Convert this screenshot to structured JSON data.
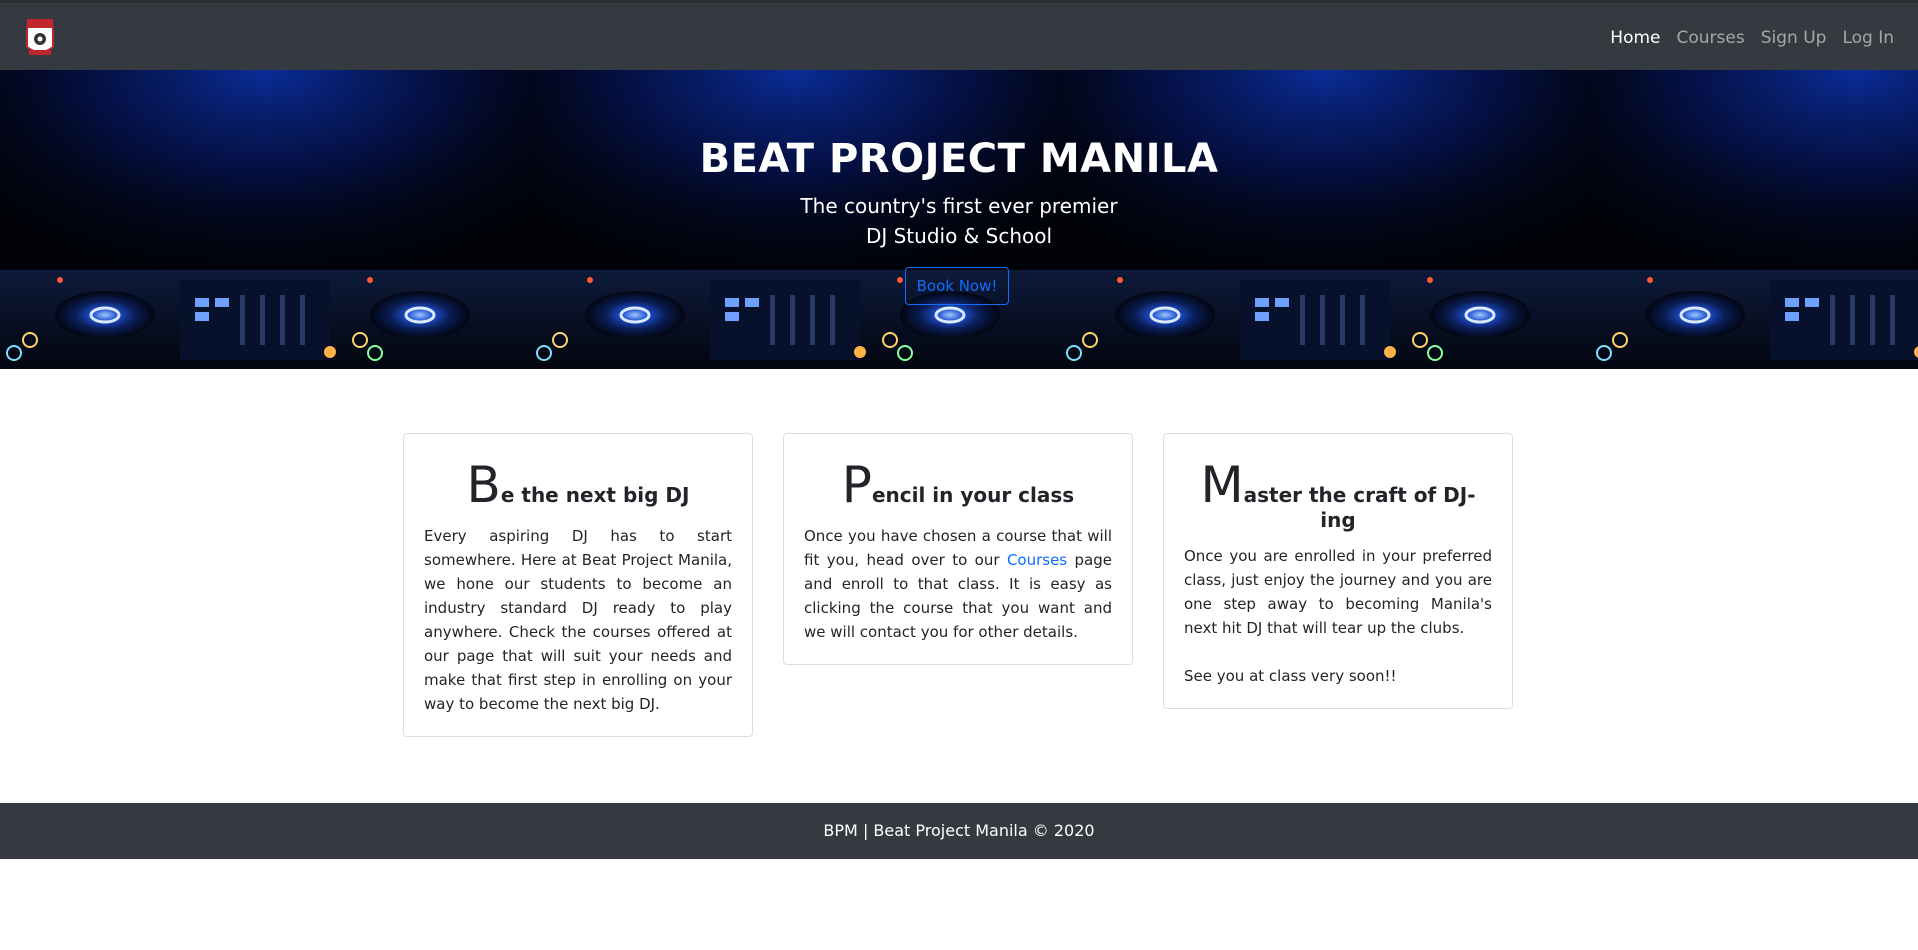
{
  "nav": {
    "logo": "logo-badge",
    "links": [
      {
        "label": "Home",
        "active": true
      },
      {
        "label": "Courses",
        "active": false
      },
      {
        "label": "Sign Up",
        "active": false
      },
      {
        "label": "Log In",
        "active": false
      }
    ]
  },
  "hero": {
    "title": "BEAT PROJECT MANILA",
    "subtitle_line1": "The country's first ever premier",
    "subtitle_line2": "DJ Studio & School",
    "button_label": "Book Now!"
  },
  "cards": [
    {
      "initial": "B",
      "title_rest": "e the next big DJ",
      "text": "Every aspiring DJ has to start somewhere. Here at Beat Project Manila, we hone our students to become an industry standard DJ ready to play anywhere. Check the courses offered at our page that will suit your needs and make that first step in enrolling on your way to become the next big DJ."
    },
    {
      "initial": "P",
      "title_rest": "encil in your class",
      "text_before": "Once you have chosen a course that will fit you, head over to our ",
      "link": "Courses",
      "text_after": " page and enroll to that class. It is easy as clicking the course that you want and we will contact you for other details."
    },
    {
      "initial": "M",
      "title_rest": "aster the craft of DJ-ing",
      "text": "Once you are enrolled in your preferred class, just enjoy the journey and you are one step away to becoming Manila's next hit DJ that will tear up the clubs.",
      "text2": "See you at class very soon!!"
    }
  ],
  "footer": {
    "text": "BPM | Beat Project Manila © 2020"
  },
  "colors": {
    "nav_bg": "#343a40",
    "accent": "#0d6efd",
    "hero_glow": "#0a2a8a"
  }
}
